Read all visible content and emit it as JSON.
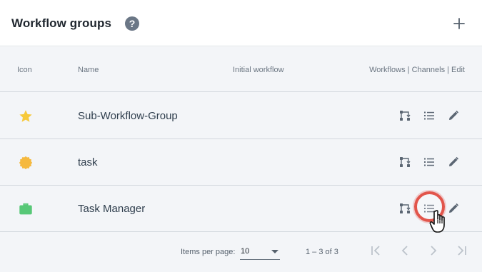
{
  "header": {
    "title": "Workflow groups",
    "help_icon": "?",
    "add_icon": "+"
  },
  "table": {
    "columns": {
      "icon": "Icon",
      "name": "Name",
      "initial_workflow": "Initial workflow",
      "actions": "Workflows | Channels | Edit"
    },
    "rows": [
      {
        "icon": "star-icon",
        "icon_color": "#f6c93a",
        "name": "Sub-Workflow-Group",
        "initial_workflow": ""
      },
      {
        "icon": "badge-icon",
        "icon_color": "#f5b93f",
        "name": "task",
        "initial_workflow": ""
      },
      {
        "icon": "briefcase-icon",
        "icon_color": "#57c877",
        "name": "Task Manager",
        "initial_workflow": ""
      }
    ]
  },
  "pagination": {
    "items_per_page_label": "Items per page:",
    "items_per_page_value": "10",
    "range_label": "1 – 3 of 3"
  },
  "colors": {
    "header_bg": "#ffffff",
    "table_bg": "#f3f5f8",
    "action_icon": "#5b6673",
    "highlight": "#e2554b"
  }
}
